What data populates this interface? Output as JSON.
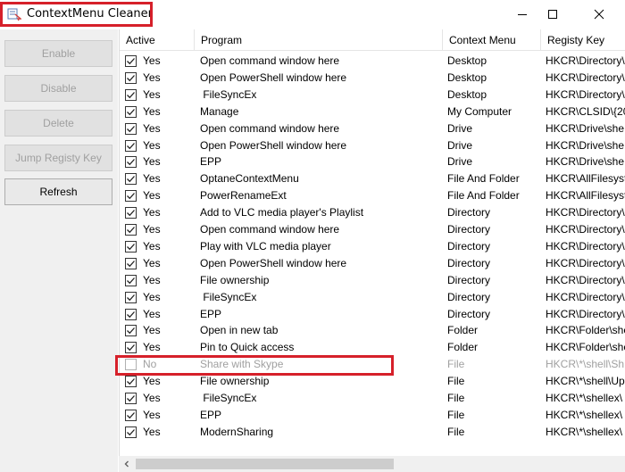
{
  "window": {
    "title": "ContextMenu Cleaner"
  },
  "buttons": {
    "enable": "Enable",
    "disable": "Disable",
    "delete": "Delete",
    "jump": "Jump Registy Key",
    "refresh": "Refresh"
  },
  "columns": {
    "active": "Active",
    "program": "Program",
    "context": "Context Menu",
    "key": "Registy Key"
  },
  "rows": [
    {
      "active": "Yes",
      "checked": true,
      "program": "Open command window here",
      "context": "Desktop",
      "key": "HKCR\\Directory\\"
    },
    {
      "active": "Yes",
      "checked": true,
      "program": "Open PowerShell window here",
      "context": "Desktop",
      "key": "HKCR\\Directory\\"
    },
    {
      "active": "Yes",
      "checked": true,
      "program": " FileSyncEx",
      "context": "Desktop",
      "key": "HKCR\\Directory\\"
    },
    {
      "active": "Yes",
      "checked": true,
      "program": "Manage",
      "context": "My Computer",
      "key": "HKCR\\CLSID\\{20"
    },
    {
      "active": "Yes",
      "checked": true,
      "program": "Open command window here",
      "context": "Drive",
      "key": "HKCR\\Drive\\she"
    },
    {
      "active": "Yes",
      "checked": true,
      "program": "Open PowerShell window here",
      "context": "Drive",
      "key": "HKCR\\Drive\\she"
    },
    {
      "active": "Yes",
      "checked": true,
      "program": "EPP",
      "context": "Drive",
      "key": "HKCR\\Drive\\she"
    },
    {
      "active": "Yes",
      "checked": true,
      "program": "OptaneContextMenu",
      "context": "File And Folder",
      "key": "HKCR\\AllFilesyst"
    },
    {
      "active": "Yes",
      "checked": true,
      "program": "PowerRenameExt",
      "context": "File And Folder",
      "key": "HKCR\\AllFilesyst"
    },
    {
      "active": "Yes",
      "checked": true,
      "program": "Add to VLC media player's Playlist",
      "context": "Directory",
      "key": "HKCR\\Directory\\"
    },
    {
      "active": "Yes",
      "checked": true,
      "program": "Open command window here",
      "context": "Directory",
      "key": "HKCR\\Directory\\"
    },
    {
      "active": "Yes",
      "checked": true,
      "program": "Play with VLC media player",
      "context": "Directory",
      "key": "HKCR\\Directory\\"
    },
    {
      "active": "Yes",
      "checked": true,
      "program": "Open PowerShell window here",
      "context": "Directory",
      "key": "HKCR\\Directory\\"
    },
    {
      "active": "Yes",
      "checked": true,
      "program": "File ownership",
      "context": "Directory",
      "key": "HKCR\\Directory\\"
    },
    {
      "active": "Yes",
      "checked": true,
      "program": " FileSyncEx",
      "context": "Directory",
      "key": "HKCR\\Directory\\"
    },
    {
      "active": "Yes",
      "checked": true,
      "program": "EPP",
      "context": "Directory",
      "key": "HKCR\\Directory\\"
    },
    {
      "active": "Yes",
      "checked": true,
      "program": "Open in new tab",
      "context": "Folder",
      "key": "HKCR\\Folder\\she"
    },
    {
      "active": "Yes",
      "checked": true,
      "program": "Pin to Quick access",
      "context": "Folder",
      "key": "HKCR\\Folder\\she"
    },
    {
      "active": "No",
      "checked": false,
      "program": "Share with Skype",
      "context": "File",
      "key": "HKCR\\*\\shell\\Sh"
    },
    {
      "active": "Yes",
      "checked": true,
      "program": "File ownership",
      "context": "File",
      "key": "HKCR\\*\\shell\\Up"
    },
    {
      "active": "Yes",
      "checked": true,
      "program": " FileSyncEx",
      "context": "File",
      "key": "HKCR\\*\\shellex\\"
    },
    {
      "active": "Yes",
      "checked": true,
      "program": "EPP",
      "context": "File",
      "key": "HKCR\\*\\shellex\\"
    },
    {
      "active": "Yes",
      "checked": true,
      "program": "ModernSharing",
      "context": "File",
      "key": "HKCR\\*\\shellex\\"
    }
  ]
}
